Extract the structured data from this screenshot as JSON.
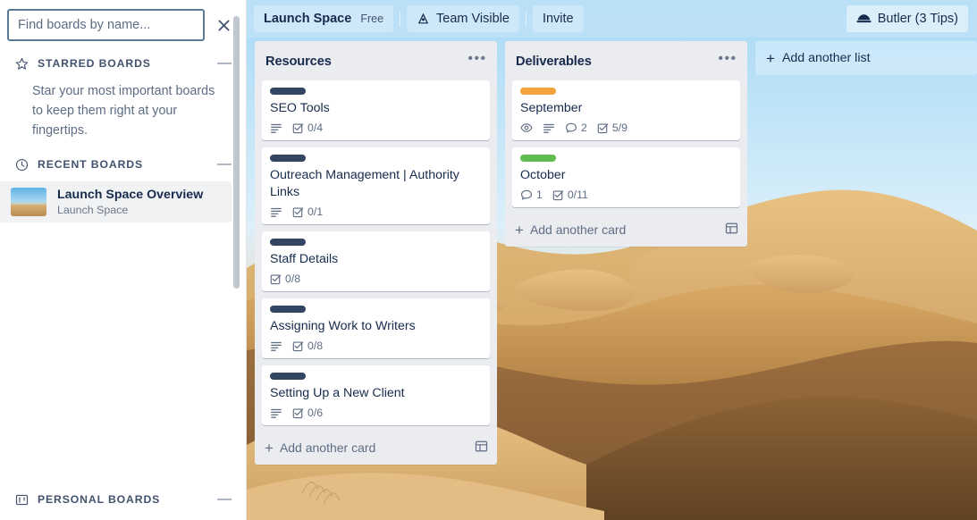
{
  "sidebar": {
    "search": {
      "placeholder": "Find boards by name...",
      "value": "",
      "close_label": "✕"
    },
    "sections": [
      {
        "key": "starred",
        "icon": "star-icon",
        "title": "STARRED BOARDS",
        "collapse_label": "—",
        "empty_text": "Star your most important boards to keep them right at your fingertips."
      },
      {
        "key": "recent",
        "icon": "clock-icon",
        "title": "RECENT BOARDS",
        "collapse_label": "—"
      },
      {
        "key": "personal",
        "icon": "board-icon",
        "title": "PERSONAL BOARDS",
        "collapse_label": "—"
      }
    ],
    "recent_boards": [
      {
        "name": "Launch Space Overview",
        "team": "Launch Space"
      }
    ]
  },
  "topbar": {
    "board_name": "Launch Space",
    "plan_badge": "Free",
    "visibility": "Team Visible",
    "visibility_icon": "people-icon",
    "invite_label": "Invite",
    "butler_label": "Butler (3 Tips)",
    "butler_icon": "butler-hat-icon"
  },
  "board": {
    "add_list_label": "Add another list",
    "lists": [
      {
        "title": "Resources",
        "menu_label": "•••",
        "add_card_label": "Add another card",
        "cards": [
          {
            "title": "SEO Tools",
            "label_color": "#344563",
            "badges": [
              {
                "type": "description",
                "text": ""
              },
              {
                "type": "checklist",
                "text": "0/4"
              }
            ]
          },
          {
            "title": "Outreach Management | Authority Links",
            "label_color": "#344563",
            "badges": [
              {
                "type": "description",
                "text": ""
              },
              {
                "type": "checklist",
                "text": "0/1"
              }
            ]
          },
          {
            "title": "Staff Details",
            "label_color": "#344563",
            "badges": [
              {
                "type": "checklist",
                "text": "0/8"
              }
            ]
          },
          {
            "title": "Assigning Work to Writers",
            "label_color": "#344563",
            "badges": [
              {
                "type": "description",
                "text": ""
              },
              {
                "type": "checklist",
                "text": "0/8"
              }
            ]
          },
          {
            "title": "Setting Up a New Client",
            "label_color": "#344563",
            "badges": [
              {
                "type": "description",
                "text": ""
              },
              {
                "type": "checklist",
                "text": "0/6"
              }
            ]
          }
        ]
      },
      {
        "title": "Deliverables",
        "menu_label": "•••",
        "add_card_label": "Add another card",
        "cards": [
          {
            "title": "September",
            "label_color": "#f2a33c",
            "badges": [
              {
                "type": "watch",
                "text": ""
              },
              {
                "type": "description",
                "text": ""
              },
              {
                "type": "comment",
                "text": "2"
              },
              {
                "type": "checklist",
                "text": "5/9"
              }
            ]
          },
          {
            "title": "October",
            "label_color": "#61bd4f",
            "badges": [
              {
                "type": "comment",
                "text": "1"
              },
              {
                "type": "checklist",
                "text": "0/11"
              }
            ]
          }
        ]
      }
    ]
  },
  "colors": {
    "list_bg": "#ebecf0",
    "card_bg": "#ffffff",
    "text_primary": "#172b4d",
    "text_muted": "#5e6c84",
    "topbar_bg": "#bfe2f8"
  }
}
